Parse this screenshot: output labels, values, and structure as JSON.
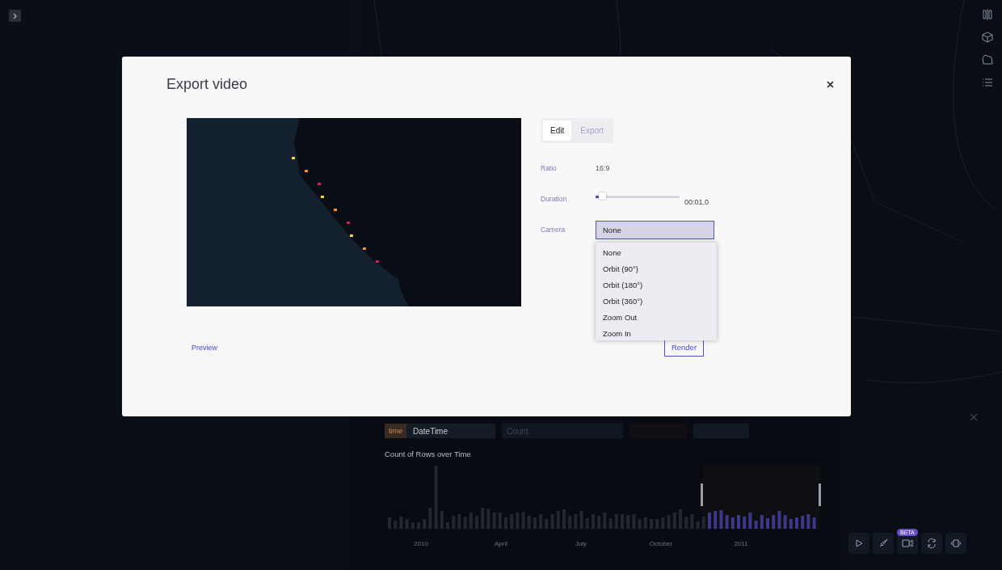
{
  "modal": {
    "title": "Export video",
    "tabs": [
      {
        "label": "Edit",
        "selected": true
      },
      {
        "label": "Export",
        "selected": false
      }
    ],
    "settings": [
      {
        "kind": "text",
        "label": "Ratio",
        "value": "16:9"
      },
      {
        "kind": "slider",
        "label": "Duration",
        "level": 0.05,
        "reading": "00:01.0"
      },
      {
        "kind": "select",
        "label": "Camera",
        "value": "None",
        "expanded": true,
        "options": [
          "None",
          "Orbit (90°)",
          "Orbit (180°)",
          "Orbit (360°)",
          "Zoom Out",
          "Zoom In"
        ]
      }
    ],
    "preview_link": "Preview",
    "render_button": "Render"
  },
  "chart_panel": {
    "time_badge": "time",
    "x_field": "DateTime",
    "y_field_placeholder": "Count",
    "chart_title": "Count of Rows over Time",
    "x_labels": [
      "2010",
      "April",
      "July",
      "October",
      "2011"
    ]
  },
  "toolbar": {
    "badge": "BETA"
  }
}
